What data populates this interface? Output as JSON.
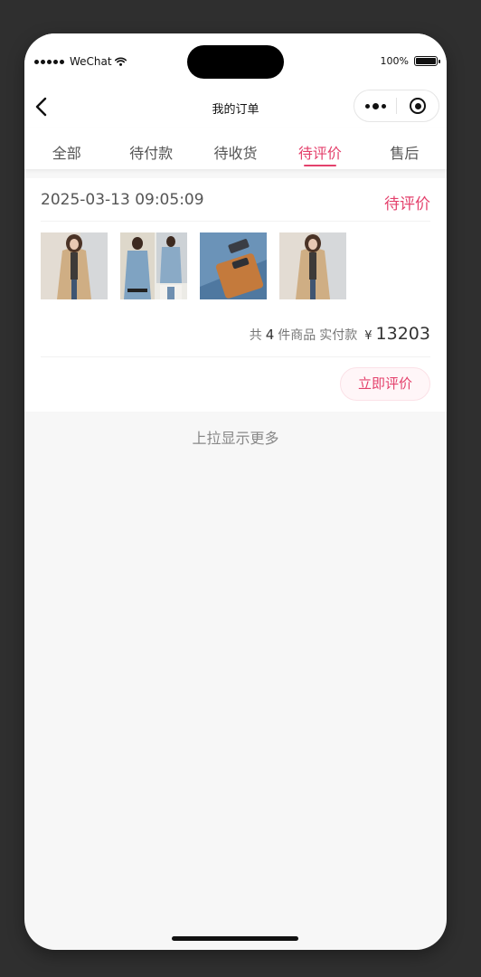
{
  "status_bar": {
    "carrier": "WeChat",
    "battery_text": "100%",
    "battery_level": 1.0
  },
  "navbar": {
    "title": "我的订单",
    "back_icon": "chevron-left-icon",
    "more_icon": "more-dots-icon",
    "close_icon": "target-circle-icon"
  },
  "tabs": [
    {
      "label": "全部",
      "active": false
    },
    {
      "label": "待付款",
      "active": false
    },
    {
      "label": "待收货",
      "active": false
    },
    {
      "label": "待评价",
      "active": true
    },
    {
      "label": "售后",
      "active": false
    }
  ],
  "order": {
    "time": "2025-03-13 09:05:09",
    "status": "待评价",
    "products": [
      {
        "image": "beige-trench-coat-photo"
      },
      {
        "image": "blue-coat-collage-photo"
      },
      {
        "image": "orange-smartphone-photo"
      },
      {
        "image": "beige-trench-coat-photo"
      }
    ],
    "summary": {
      "prefix": "共",
      "count": "4",
      "suffix": "件商品",
      "paid_label": "实付款",
      "currency": "¥",
      "amount": "13203"
    },
    "review_button": "立即评价"
  },
  "load_more": "上拉显示更多",
  "colors": {
    "accent": "#e4416c",
    "background": "#f7f7f7",
    "frame": "#2f2f2f"
  }
}
